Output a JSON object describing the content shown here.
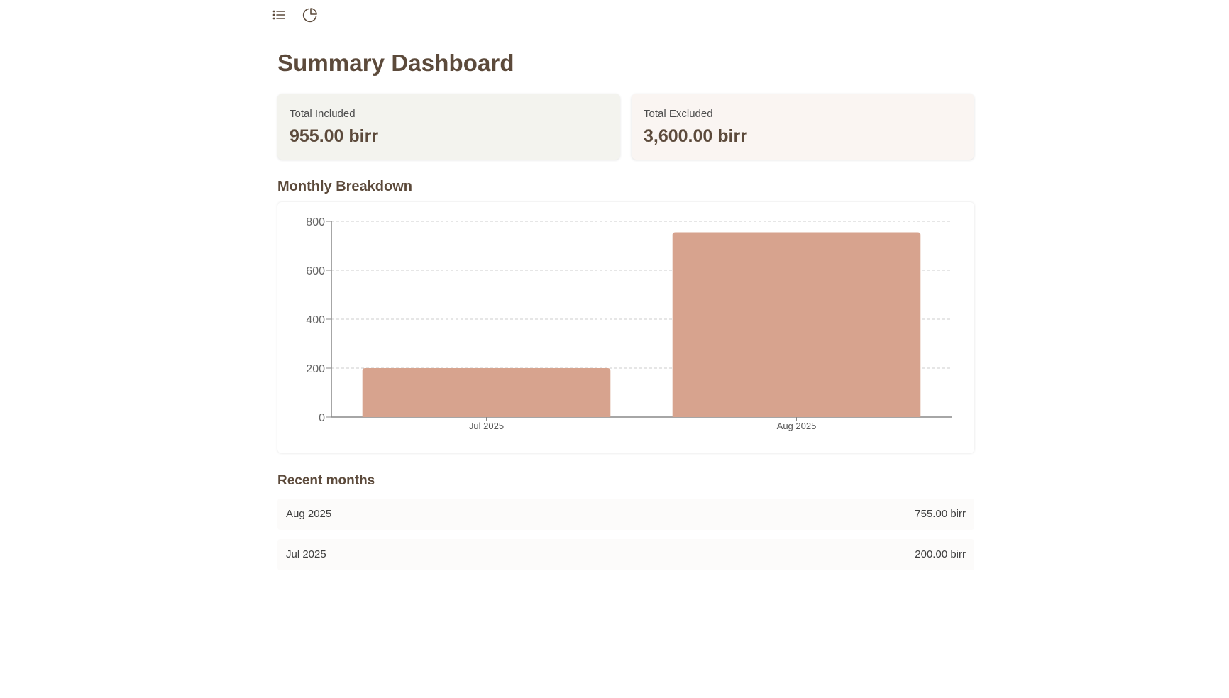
{
  "nav": {
    "icons": [
      "list-icon",
      "pie-chart-icon"
    ]
  },
  "page": {
    "title": "Summary Dashboard"
  },
  "summary": {
    "included": {
      "label": "Total Included",
      "value": "955.00 birr"
    },
    "excluded": {
      "label": "Total Excluded",
      "value": "3,600.00 birr"
    }
  },
  "monthly": {
    "title": "Monthly Breakdown"
  },
  "chart_data": {
    "type": "bar",
    "categories": [
      "Jul 2025",
      "Aug 2025"
    ],
    "values": [
      200,
      755
    ],
    "title": "",
    "xlabel": "",
    "ylabel": "",
    "ylim": [
      0,
      800
    ],
    "yticks": [
      0,
      200,
      400,
      600,
      800
    ],
    "grid": true,
    "bar_color": "#d7a38e"
  },
  "recent": {
    "title": "Recent months",
    "items": [
      {
        "month": "Aug 2025",
        "amount": "755.00 birr"
      },
      {
        "month": "Jul 2025",
        "amount": "200.00 birr"
      }
    ]
  },
  "colors": {
    "text": "#5c4a3b",
    "included_bg": "#f3f3ee",
    "excluded_bg": "#faf5f2"
  }
}
